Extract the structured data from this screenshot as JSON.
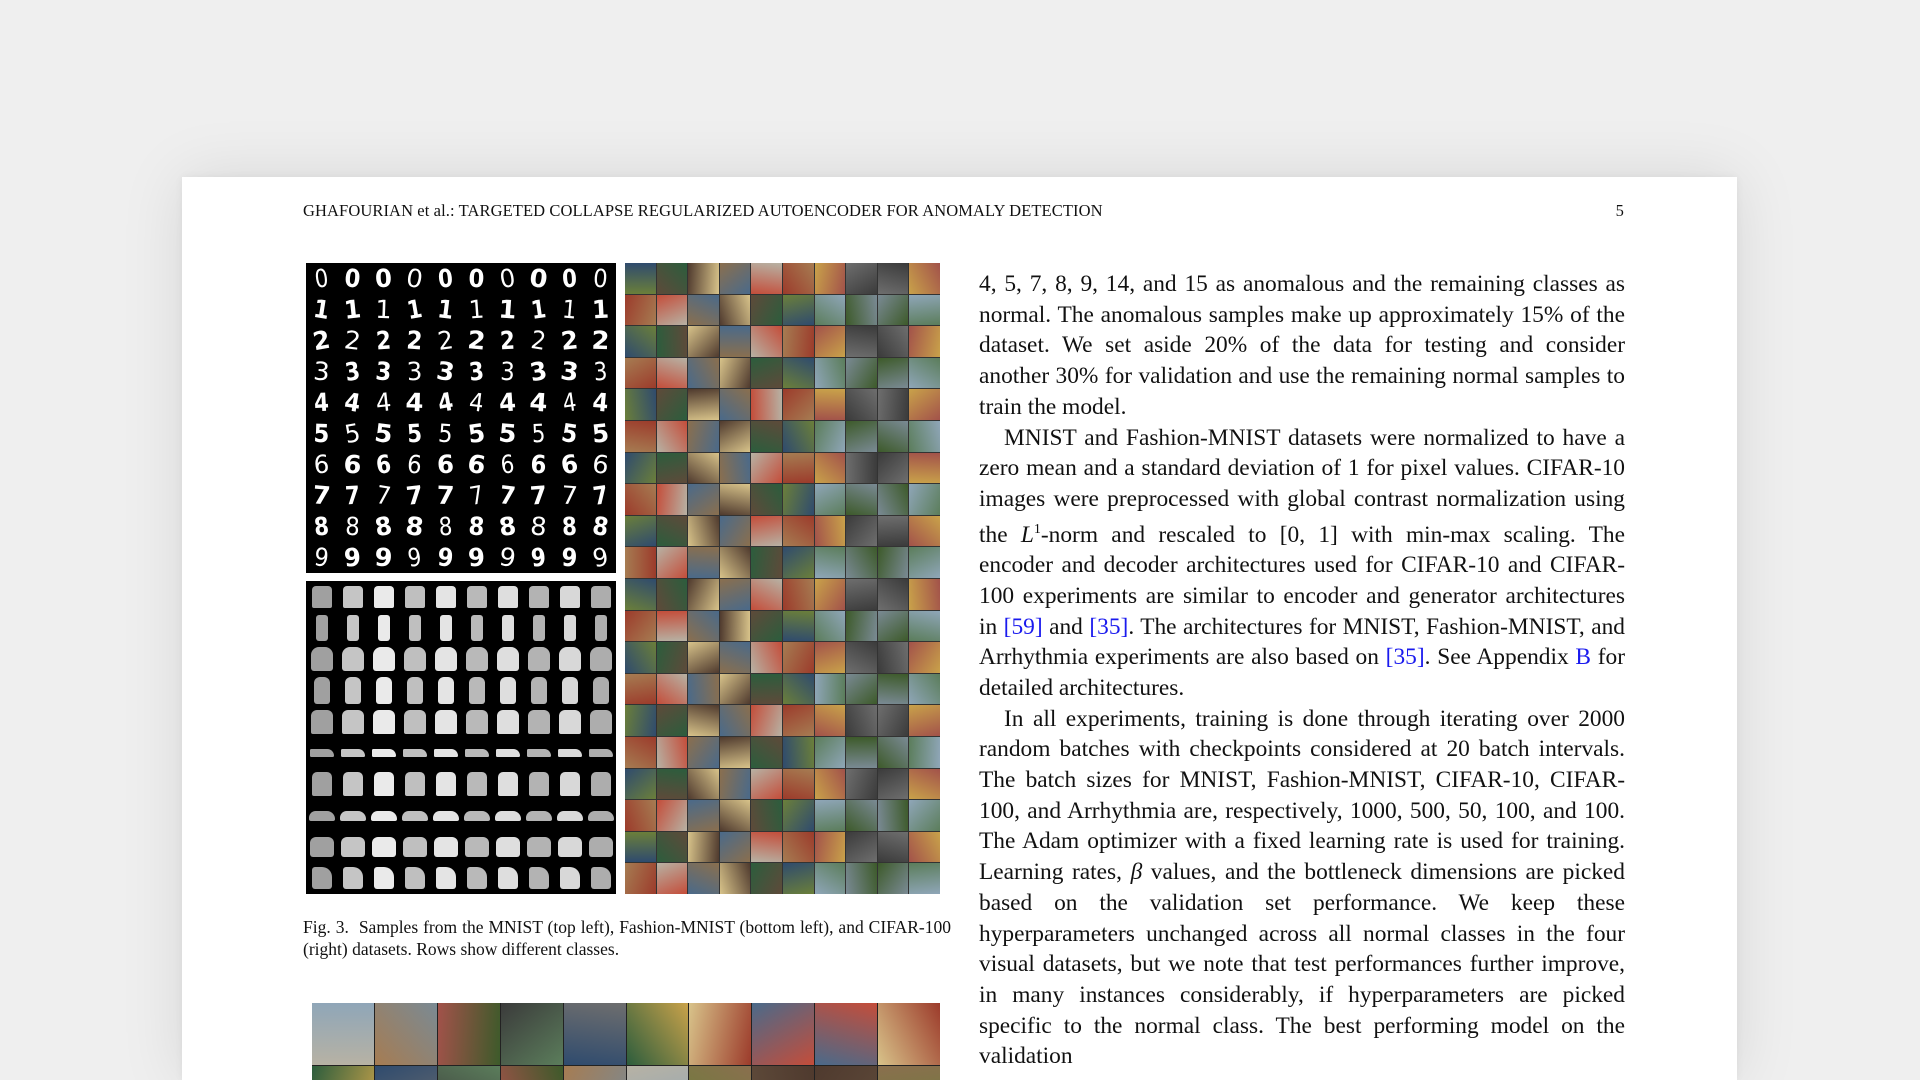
{
  "running_head": {
    "title": "GHAFOURIAN et al.: TARGETED COLLAPSE REGULARIZED AUTOENCODER FOR ANOMALY DETECTION",
    "page_number": "5"
  },
  "figure": {
    "mnist_digits": [
      "0",
      "1",
      "2",
      "3",
      "4",
      "5",
      "6",
      "7",
      "8",
      "9"
    ],
    "caption_label": "Fig. 3.",
    "caption_text": "Samples from the MNIST (top left), Fashion-MNIST (bottom left), and CIFAR-100 (right) datasets. Rows show different classes."
  },
  "body": {
    "p1": "4, 5, 7, 8, 9, 14, and 15 as anomalous and the remaining classes as normal. The anomalous samples make up approximately 15% of the dataset. We set aside 20% of the data for testing and consider another 30% for validation and use the remaining normal samples to train the model.",
    "p2_a": "MNIST and Fashion-MNIST datasets were normalized to have a zero mean and a standard deviation of 1 for pixel values. CIFAR-10 images were preprocessed with global contrast normalization using the ",
    "p2_math": "L",
    "p2_sup": "1",
    "p2_b": "-norm and rescaled to [0, 1] with min-max scaling. The encoder and decoder architectures used for CIFAR-10 and CIFAR-100 experiments are similar to encoder and generator architectures in ",
    "p2_ref1": "[59]",
    "p2_c": " and ",
    "p2_ref2": "[35]",
    "p2_d": ". The architectures for MNIST, Fashion-MNIST, and Arrhythmia experiments are also based on ",
    "p2_ref3": "[35]",
    "p2_e": ". See Appendix ",
    "p2_ref4": "B",
    "p2_f": " for detailed architectures.",
    "p3_a": "In all experiments, training is done through iterating over 2000 random batches with checkpoints considered at 20 batch intervals. The batch sizes for MNIST, Fashion-MNIST, CIFAR-10, CIFAR-100, and Arrhythmia are, respectively, 1000, 500, 50, 100, and 100. The Adam optimizer with a fixed learning rate is used for training. Learning rates, ",
    "p3_beta": "β",
    "p3_b": " values, and the bottleneck dimensions are picked based on the validation set performance. We keep these hyperparameters unchanged across all normal classes in the four visual datasets, but we note that test performances further improve, in many instances considerably, if hyperparameters are picked specific to the normal class. The best performing model on the validation"
  },
  "colors": {
    "background": "#efefef",
    "page": "#ffffff",
    "text": "#111111",
    "link": "#1a1aee"
  }
}
